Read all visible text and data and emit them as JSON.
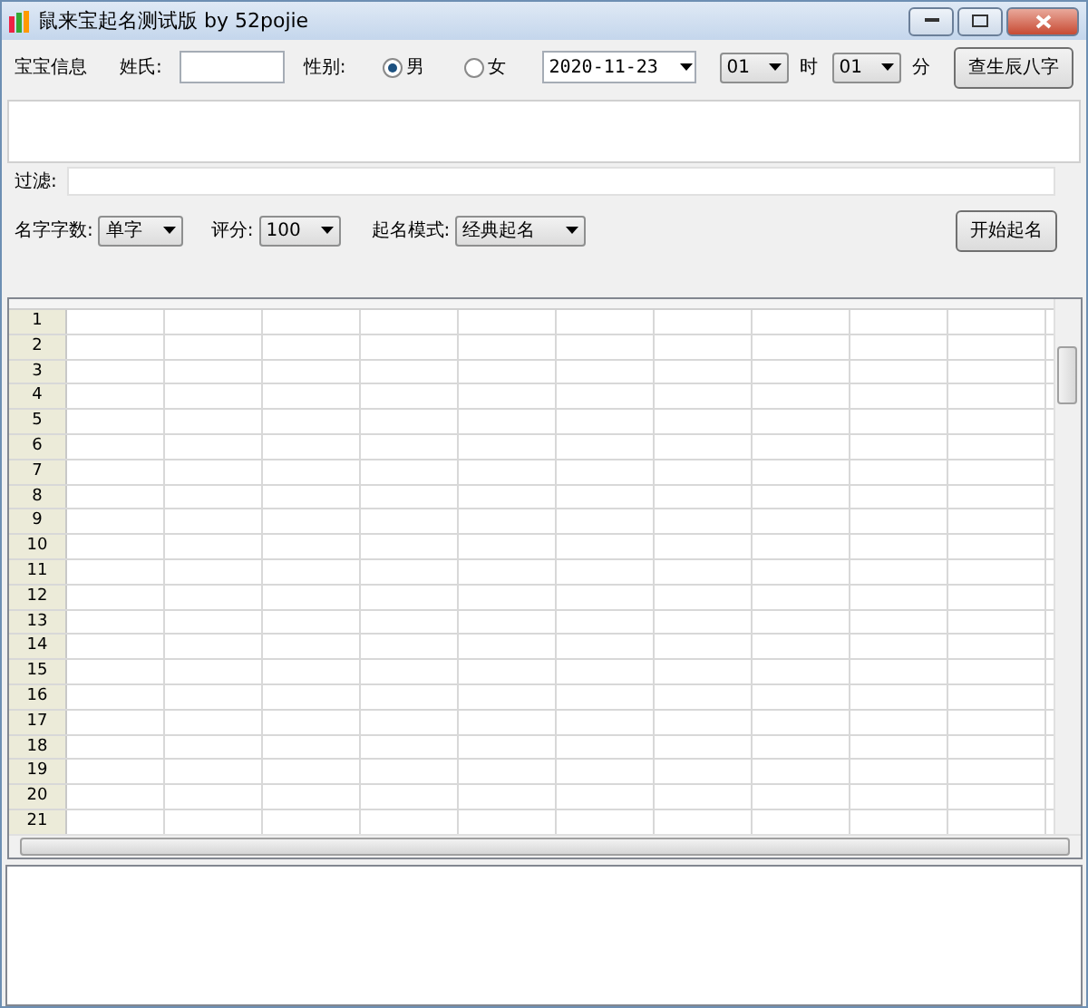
{
  "window": {
    "title": "鼠来宝起名测试版 by 52pojie"
  },
  "baby_info": {
    "label": "宝宝信息",
    "surname_label": "姓氏:",
    "gender_label": "性别:",
    "genders": [
      {
        "label": "男",
        "selected": true
      },
      {
        "label": "女",
        "selected": false
      }
    ],
    "date": "2020-11-23",
    "hour": "01",
    "hour_label": "时",
    "minute": "01",
    "minute_label": "分",
    "button": "查生辰八字"
  },
  "filter": {
    "label": "过滤:"
  },
  "options": {
    "length_label": "名字字数:",
    "length": "单字",
    "score_label": "评分:",
    "score": "100",
    "mode_label": "起名模式:",
    "mode": "经典起名",
    "button": "开始起名"
  },
  "grid": {
    "row_headers": [
      "1",
      "2",
      "3",
      "4",
      "5",
      "6",
      "7",
      "8",
      "9",
      "10",
      "11",
      "12",
      "13",
      "14",
      "15",
      "16",
      "17",
      "18",
      "19",
      "20",
      "21"
    ]
  }
}
